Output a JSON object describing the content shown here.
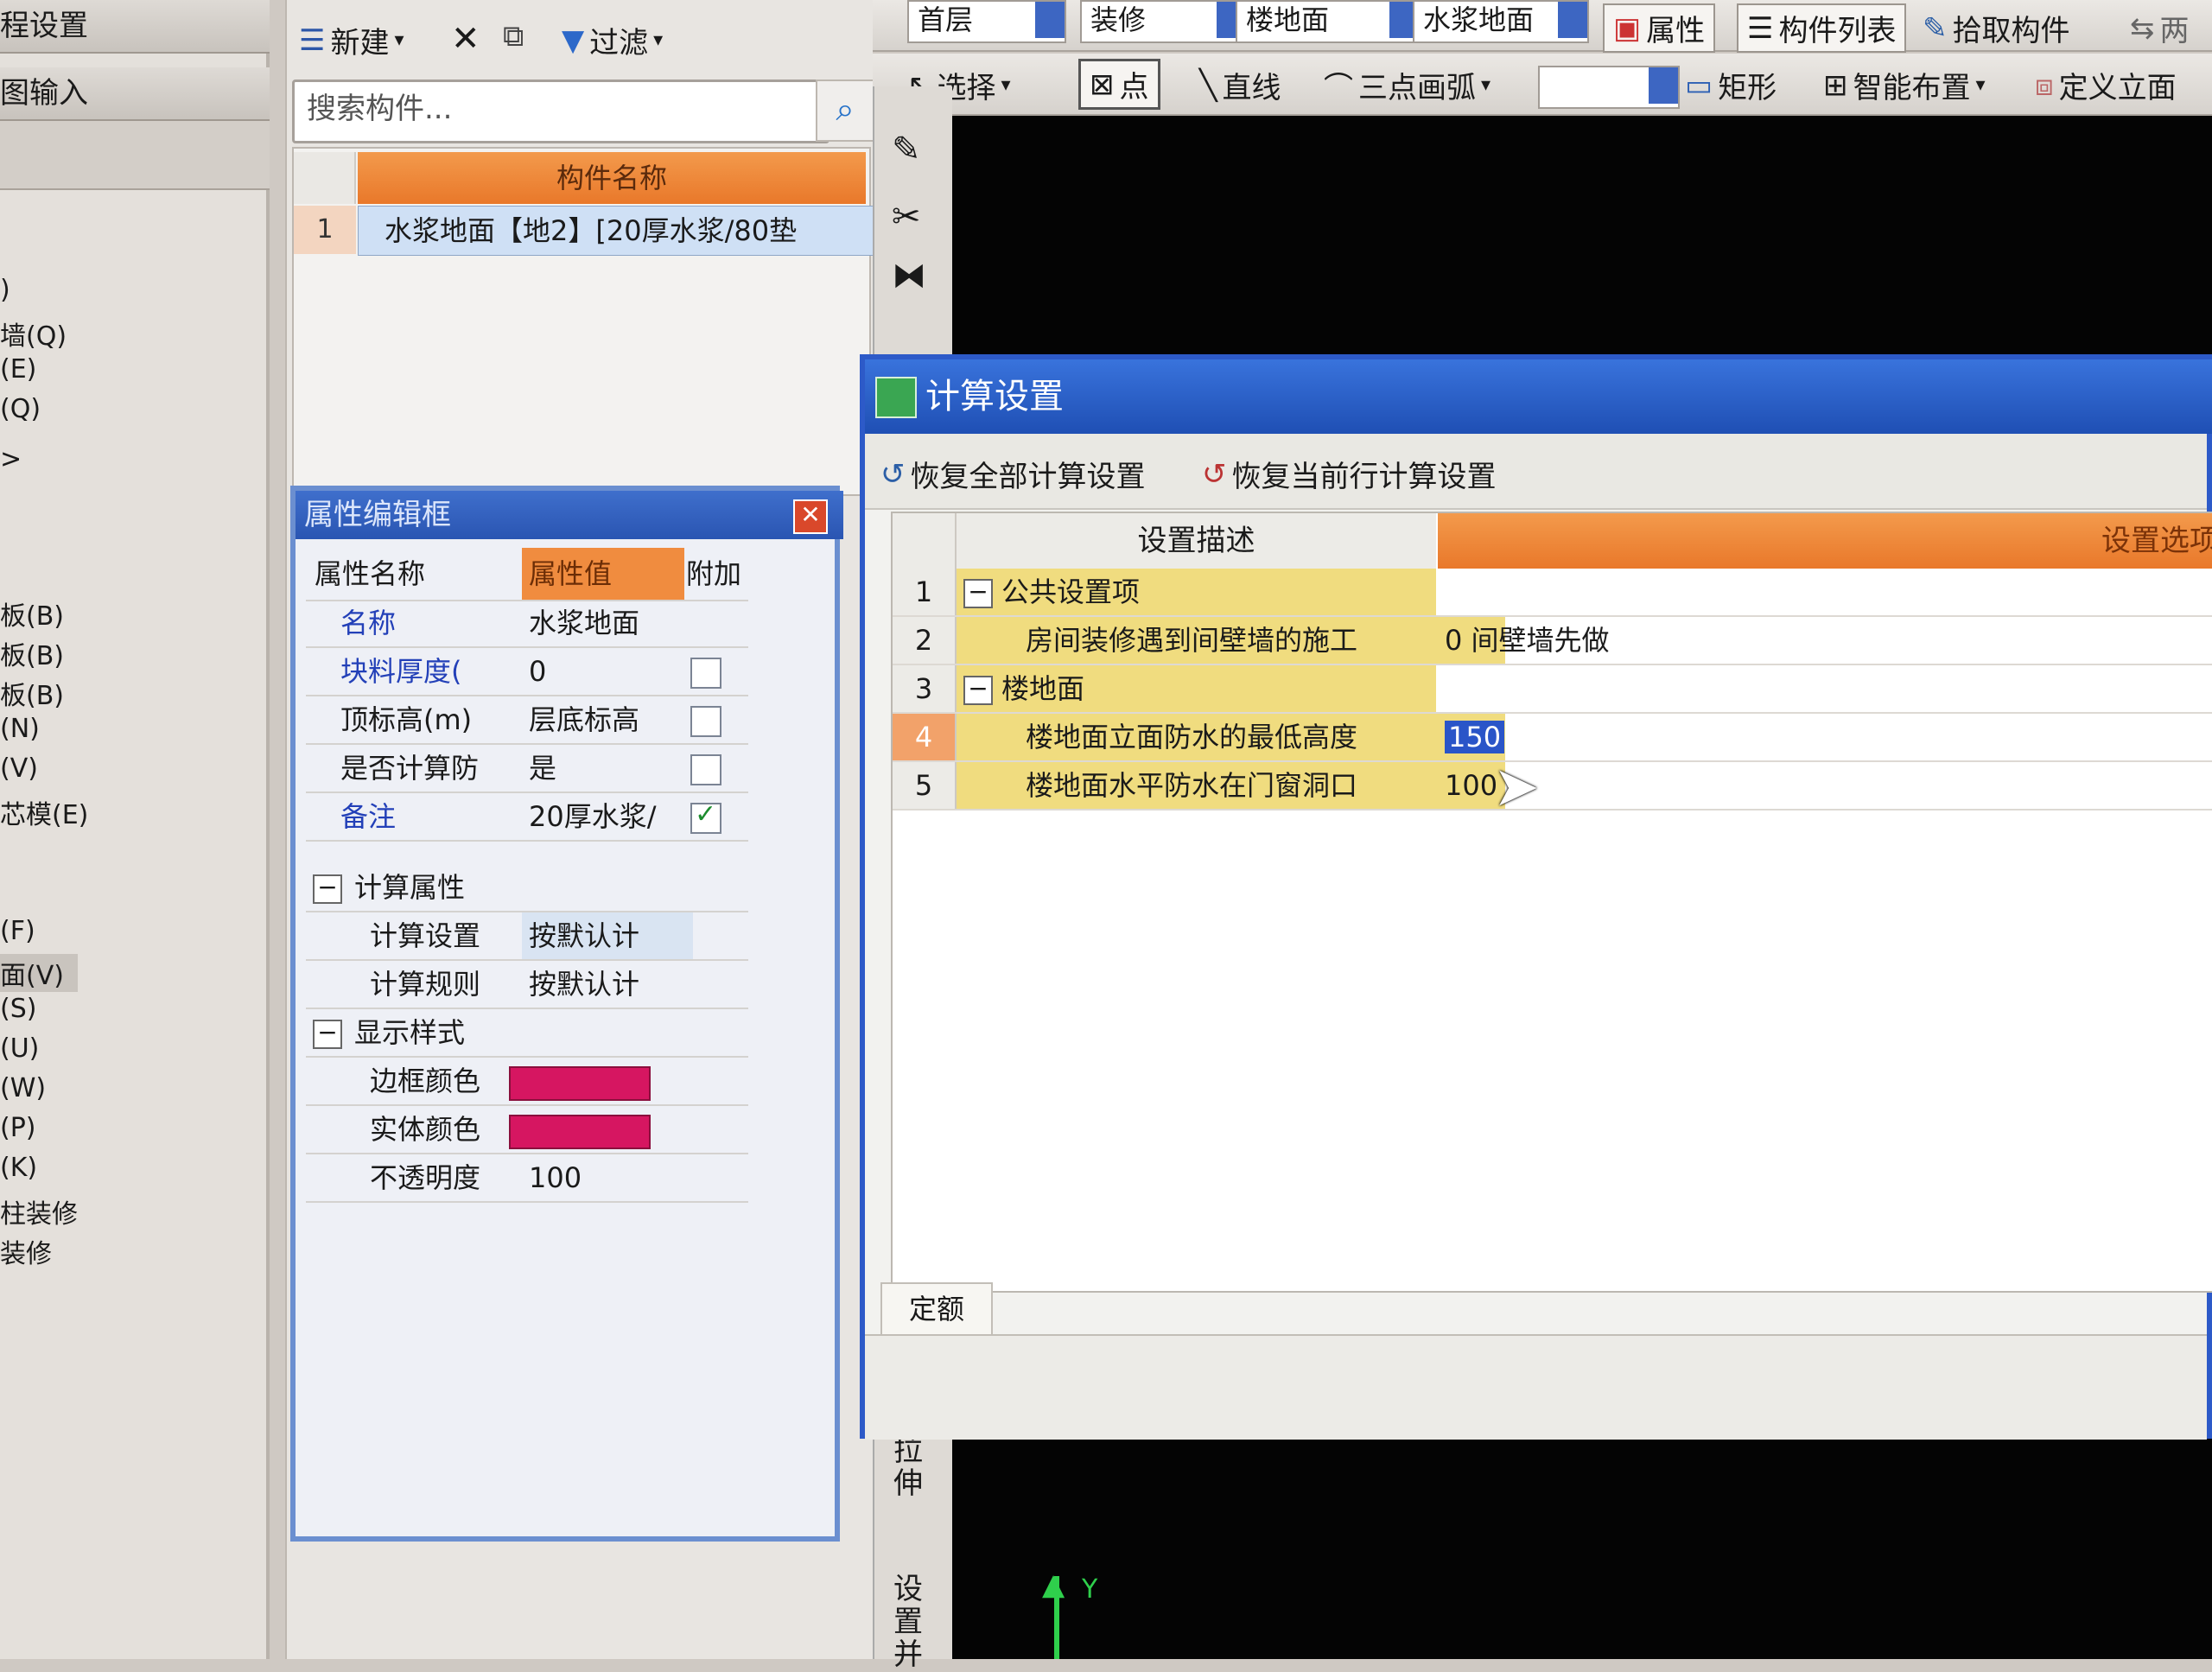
{
  "leftnav": {
    "headers": [
      "程设置",
      "图输入"
    ],
    "items": [
      ")",
      "墙(Q)",
      "(E)",
      "(Q)",
      ">",
      "板(B)",
      "板(B)",
      "板(B)",
      "(N)",
      "(V)",
      "芯模(E)",
      "(F)",
      "面(V)",
      "(S)",
      "(U)",
      "(W)",
      "(P)",
      "(K)",
      "柱装修",
      "装修"
    ]
  },
  "comp": {
    "new_label": "新建",
    "filter_label": "过滤",
    "search_placeholder": "搜索构件...",
    "grid_header": "构件名称",
    "rows": [
      {
        "index": "1",
        "name": "水浆地面【地2】[20厚水浆/80垫"
      }
    ]
  },
  "prop": {
    "title": "属性编辑框",
    "headers": {
      "name": "属性名称",
      "value": "属性值",
      "extra": "附加"
    },
    "rows": [
      {
        "name": "名称",
        "value": "水浆地面",
        "check": null,
        "blue": true
      },
      {
        "name": "块料厚度(",
        "value": "0",
        "check": false,
        "blue": true
      },
      {
        "name": "顶标高(m)",
        "value": "层底标高",
        "check": false,
        "blue": false
      },
      {
        "name": "是否计算防",
        "value": "是",
        "check": false,
        "blue": false
      },
      {
        "name": "备注",
        "value": "20厚水浆/",
        "check": true,
        "blue": true
      }
    ],
    "group_calc": "计算属性",
    "calc_setting": {
      "name": "计算设置",
      "value": "按默认计"
    },
    "calc_rule": {
      "name": "计算规则",
      "value": "按默认计"
    },
    "group_display": "显示样式",
    "border_color": {
      "name": "边框颜色",
      "color": "#d61661"
    },
    "fill_color": {
      "name": "实体颜色",
      "color": "#d61661"
    },
    "opacity": {
      "name": "不透明度",
      "value": "100"
    }
  },
  "topbar": {
    "combos": [
      "首层",
      "装修",
      "楼地面",
      "水浆地面"
    ],
    "attr_btn": "属性",
    "list_btn": "构件列表",
    "pick_btn": "拾取构件",
    "two_btn": "两",
    "select": "选择",
    "point": "点",
    "line": "直线",
    "arc": "三点画弧",
    "rect": "矩形",
    "smart": "智能布置",
    "elev": "定义立面"
  },
  "sidetool": {
    "stretch": "拉伸",
    "setup": "设置并"
  },
  "canvas": {
    "y_axis": "Y"
  },
  "dialog": {
    "title": "计算设置",
    "restore_all": "恢复全部计算设置",
    "restore_row": "恢复当前行计算设置",
    "col_desc": "设置描述",
    "col_opt": "设置选项",
    "rows": [
      {
        "n": "1",
        "desc": "公共设置项",
        "opt": "",
        "group": true
      },
      {
        "n": "2",
        "desc": "房间装修遇到间壁墙的施工",
        "opt": "0 间壁墙先做",
        "group": false
      },
      {
        "n": "3",
        "desc": "楼地面",
        "opt": "",
        "group": true
      },
      {
        "n": "4",
        "desc": "楼地面立面防水的最低高度",
        "opt": "150",
        "group": false,
        "selected": true
      },
      {
        "n": "5",
        "desc": "楼地面水平防水在门窗洞口",
        "opt": "100",
        "group": false
      }
    ],
    "tab": "定额"
  }
}
